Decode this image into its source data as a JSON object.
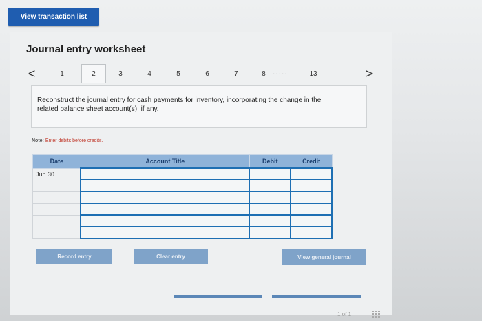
{
  "top_button": {
    "label": "View transaction list"
  },
  "worksheet": {
    "title": "Journal entry worksheet",
    "pages": [
      "1",
      "2",
      "3",
      "4",
      "5",
      "6",
      "7",
      "8",
      "13"
    ],
    "ellipsis": "·····",
    "prev": "<",
    "next": ">",
    "active_page": "2",
    "instruction": "Reconstruct the journal entry for cash payments for inventory, incorporating the change in the related balance sheet account(s), if any.",
    "note_label": "Note:",
    "note_text": "Enter debits before credits."
  },
  "table": {
    "headers": {
      "date": "Date",
      "account": "Account Title",
      "debit": "Debit",
      "credit": "Credit"
    },
    "first_date": "Jun 30"
  },
  "buttons": {
    "record": "Record entry",
    "clear": "Clear entry",
    "view_journal": "View general journal"
  },
  "footer": {
    "page_of": "1 of 1"
  },
  "colors": {
    "accent": "#1f5db0",
    "header": "#8fb3d9"
  }
}
